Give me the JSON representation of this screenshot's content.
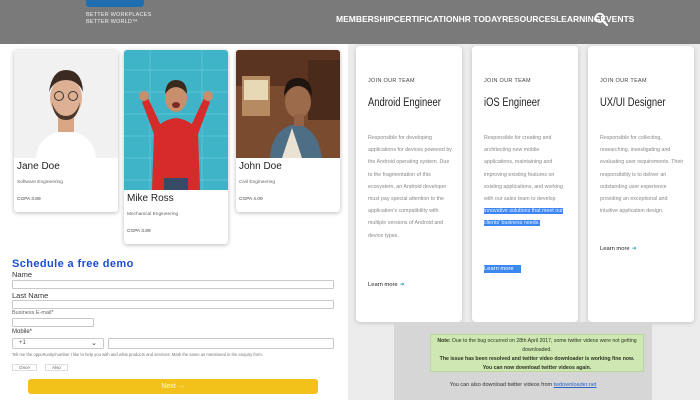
{
  "header": {
    "logo_tagline_1": "BETTER WORKPLACES",
    "logo_tagline_2": "BETTER WORLD™",
    "nav": [
      "MEMBERSHIP",
      "CERTIFICATION",
      "HR TODAY",
      "RESOURCES",
      "LEARNING",
      "EVENTS"
    ],
    "search_icon": "search-icon"
  },
  "profiles": [
    {
      "name": "Jane Doe",
      "major": "Software Engineering",
      "gpa": "CGPA 3.89"
    },
    {
      "name": "Mike Ross",
      "major": "Mechanical Engineering",
      "gpa": "CGPA 3.89"
    },
    {
      "name": "John Doe",
      "major": "Civil Engineering",
      "gpa": "CGPA 4.09"
    }
  ],
  "form": {
    "title": "Schedule a free demo",
    "labels": {
      "name": "Name",
      "last_name": "Last Name",
      "phone": "Business E-mail*",
      "mobile": "Mobile*"
    },
    "select_value": "+1",
    "note": "Tell me the opportunity/number I like to help you with and what products and services. Mark the same as mentioned in the enquiry form.",
    "radios": [
      "Once",
      "Also"
    ],
    "next_label": "Next →"
  },
  "jobs": [
    {
      "eyebrow": "JOIN OUR TEAM",
      "title": "Android Engineer",
      "desc": "Responsible for developing applications for devices powered by the Android operating system. Due to the fragmentation of this ecosystem, an Android developer must pay special attention to the application's compatibility with multiple versions of Android and device types.",
      "learn": "Learn more"
    },
    {
      "eyebrow": "JOIN OUR TEAM",
      "title": "iOS Engineer",
      "desc_before": "Responsible for creating and architecting new mobile applications, maintaining and improving existing features on existing applications, and working with our sales team to develop",
      "desc_highlight": "innovative solutions that meet our clients' business needs.",
      "learn": "Learn more"
    },
    {
      "eyebrow": "JOIN OUR TEAM",
      "title": "UX/UI Designer",
      "desc": "Responsible for collecting, researching, investigating and evaluating user requirements. Their responsibility is to deliver an outstanding user experience providing an exceptional and intuitive application design.",
      "learn": "Learn more"
    }
  ],
  "notice": {
    "label": "Note:",
    "text_1": "Due to the bug occurred on 28th April 2017, some twitter videos were not getting downloaded.",
    "text_2": "The issue has been resolved and twitter video downloader is working fine now. You can now download twitter videos again.",
    "download_text": "You can also download twitter videos from",
    "download_link": "twdownloader.net"
  },
  "colors": {
    "header_bg": "#7a7a7a",
    "logo_blue": "#1f6fb0",
    "form_title": "#1a4fd4",
    "next_button": "#f3c21a",
    "highlight": "#3d87f5",
    "notice_bg": "#cfe8b2"
  }
}
